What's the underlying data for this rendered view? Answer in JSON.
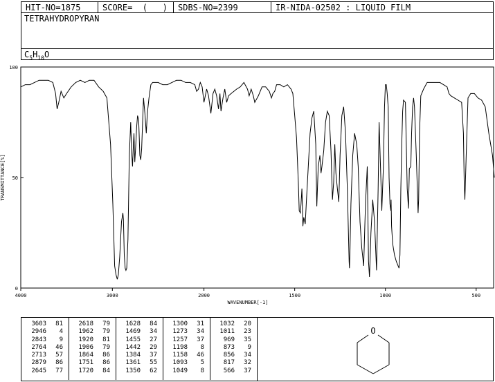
{
  "header": {
    "hit_no": "HIT-NO=1875",
    "score": "SCORE=  (   )",
    "sdbs_no": "SDBS-NO=2399",
    "ir_info": "IR-NIDA-02502 : LIQUID FILM"
  },
  "compound_name": "TETRAHYDROPYRAN",
  "formula": {
    "c": "C",
    "c_n": "5",
    "h": "H",
    "h_n": "10",
    "o": "O"
  },
  "chart_data": {
    "type": "line",
    "xlabel": "WAVENUMBER[-1]",
    "ylabel": "TRANSMITTANCE[%]",
    "xlim": [
      4000,
      400
    ],
    "ylim": [
      0,
      100
    ],
    "x_ticks": [
      4000,
      3000,
      2000,
      1500,
      1000,
      500
    ],
    "y_ticks": [
      100,
      50,
      0
    ],
    "line_color": "#000000",
    "series": [
      {
        "x": [
          4000,
          3950,
          3900,
          3850,
          3800,
          3750,
          3700,
          3650,
          3620,
          3603,
          3585,
          3560,
          3530,
          3500,
          3450,
          3400,
          3350,
          3300,
          3250,
          3200,
          3150,
          3100,
          3060,
          3020,
          2995,
          2975,
          2960,
          2946,
          2935,
          2920,
          2900,
          2885,
          2879,
          2870,
          2860,
          2852,
          2843,
          2830,
          2815,
          2800,
          2790,
          2780,
          2770,
          2764,
          2755,
          2745,
          2735,
          2725,
          2713,
          2700,
          2690,
          2680,
          2670,
          2660,
          2645,
          2630,
          2618,
          2600,
          2580,
          2560,
          2540,
          2500,
          2450,
          2400,
          2350,
          2300,
          2250,
          2200,
          2150,
          2100,
          2080,
          2060,
          2040,
          2020,
          2000,
          1985,
          1975,
          1962,
          1950,
          1940,
          1930,
          1920,
          1912,
          1906,
          1895,
          1885,
          1875,
          1864,
          1850,
          1820,
          1800,
          1780,
          1760,
          1751,
          1740,
          1728,
          1720,
          1700,
          1680,
          1660,
          1640,
          1628,
          1620,
          1610,
          1600,
          1580,
          1560,
          1540,
          1520,
          1510,
          1500,
          1490,
          1480,
          1475,
          1469,
          1465,
          1460,
          1455,
          1450,
          1442,
          1435,
          1425,
          1415,
          1405,
          1395,
          1384,
          1378,
          1370,
          1361,
          1355,
          1350,
          1340,
          1330,
          1320,
          1310,
          1300,
          1292,
          1285,
          1279,
          1273,
          1265,
          1257,
          1250,
          1240,
          1230,
          1220,
          1210,
          1200,
          1198,
          1195,
          1190,
          1180,
          1170,
          1158,
          1150,
          1140,
          1130,
          1120,
          1110,
          1100,
          1093,
          1088,
          1080,
          1070,
          1060,
          1049,
          1040,
          1035,
          1032,
          1027,
          1020,
          1011,
          1005,
          1000,
          995,
          990,
          985,
          980,
          975,
          970,
          969,
          966,
          960,
          950,
          940,
          930,
          925,
          920,
          915,
          910,
          905,
          900,
          890,
          880,
          873,
          868,
          860,
          856,
          850,
          845,
          840,
          830,
          820,
          817,
          812,
          805,
          790,
          770,
          750,
          720,
          700,
          680,
          660,
          650,
          640,
          620,
          600,
          580,
          570,
          566,
          562,
          555,
          545,
          530,
          510,
          490,
          470,
          450,
          430,
          410,
          400
        ],
        "y": [
          91,
          92,
          92,
          93,
          94,
          94,
          94,
          93,
          88,
          81,
          84,
          89,
          86,
          88,
          91,
          93,
          94,
          93,
          94,
          94,
          91,
          89,
          86,
          65,
          38,
          10,
          6,
          4,
          6,
          14,
          30,
          34,
          31,
          15,
          9,
          8,
          9,
          22,
          60,
          75,
          62,
          55,
          65,
          70,
          57,
          64,
          73,
          78,
          76,
          60,
          58,
          63,
          75,
          86,
          79,
          70,
          79,
          86,
          92,
          93,
          93,
          93,
          92,
          92,
          93,
          94,
          94,
          93,
          93,
          92,
          89,
          90,
          93,
          91,
          84,
          90,
          87,
          79,
          88,
          90,
          87,
          81,
          88,
          80,
          86,
          90,
          84,
          87,
          88,
          90,
          91,
          93,
          90,
          87,
          90,
          87,
          84,
          87,
          91,
          91,
          89,
          86,
          88,
          89,
          92,
          92,
          91,
          92,
          90,
          88,
          78,
          68,
          48,
          35,
          34,
          38,
          45,
          28,
          32,
          29,
          40,
          55,
          70,
          77,
          80,
          65,
          37,
          55,
          60,
          52,
          55,
          62,
          75,
          80,
          78,
          62,
          40,
          48,
          65,
          52,
          45,
          39,
          60,
          78,
          82,
          70,
          45,
          12,
          9,
          18,
          38,
          60,
          70,
          65,
          55,
          30,
          18,
          10,
          38,
          55,
          12,
          5,
          25,
          40,
          30,
          8,
          45,
          75,
          68,
          55,
          35,
          55,
          82,
          92,
          92,
          88,
          82,
          50,
          38,
          35,
          40,
          28,
          20,
          15,
          12,
          10,
          9,
          15,
          45,
          65,
          80,
          85,
          84,
          45,
          36,
          54,
          55,
          70,
          82,
          86,
          82,
          60,
          34,
          40,
          70,
          87,
          90,
          93,
          93,
          93,
          93,
          92,
          91,
          88,
          87,
          86,
          85,
          84,
          70,
          48,
          40,
          60,
          86,
          88,
          88,
          86,
          85,
          82,
          70,
          60,
          50
        ]
      }
    ]
  },
  "peak_table": {
    "columns": [
      [
        [
          3603,
          81
        ],
        [
          2946,
          4
        ],
        [
          2843,
          9
        ],
        [
          2764,
          46
        ],
        [
          2713,
          57
        ],
        [
          2879,
          86
        ],
        [
          2645,
          77
        ]
      ],
      [
        [
          2618,
          79
        ],
        [
          1962,
          79
        ],
        [
          1920,
          81
        ],
        [
          1906,
          79
        ],
        [
          1864,
          86
        ],
        [
          1751,
          86
        ],
        [
          1720,
          84
        ]
      ],
      [
        [
          1628,
          84
        ],
        [
          1469,
          34
        ],
        [
          1455,
          27
        ],
        [
          1442,
          29
        ],
        [
          1384,
          37
        ],
        [
          1361,
          55
        ],
        [
          1350,
          62
        ]
      ],
      [
        [
          1300,
          31
        ],
        [
          1273,
          34
        ],
        [
          1257,
          37
        ],
        [
          1198,
          8
        ],
        [
          1158,
          46
        ],
        [
          1093,
          5
        ],
        [
          1049,
          8
        ]
      ],
      [
        [
          1032,
          20
        ],
        [
          1011,
          23
        ],
        [
          969,
          35
        ],
        [
          873,
          9
        ],
        [
          856,
          34
        ],
        [
          817,
          32
        ],
        [
          566,
          37
        ]
      ]
    ]
  }
}
